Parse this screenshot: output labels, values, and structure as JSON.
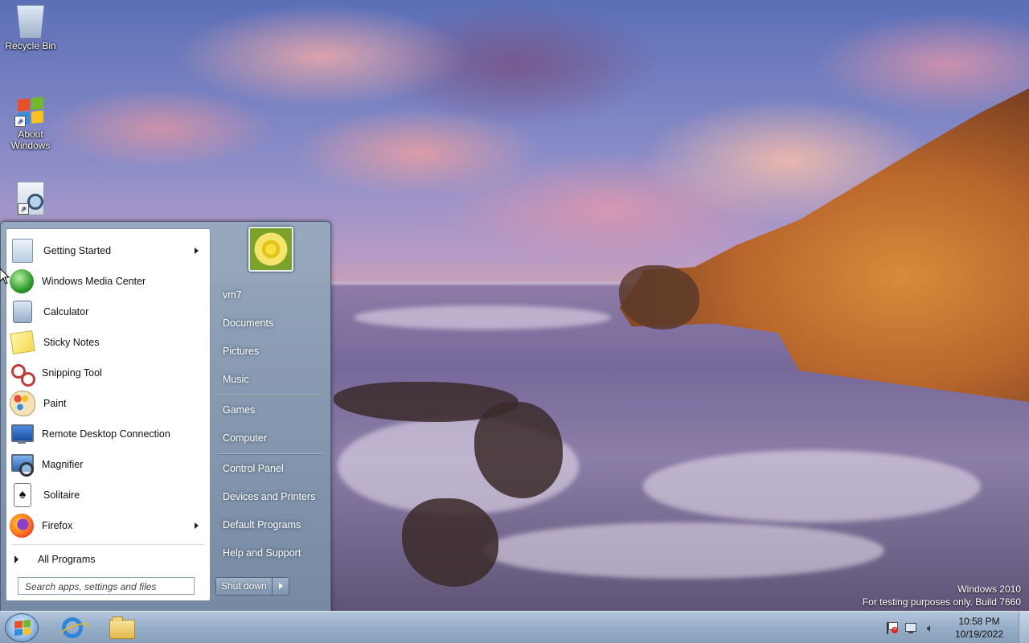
{
  "desktop": {
    "icons": [
      {
        "label": "Recycle Bin"
      },
      {
        "label": "About\nWindows"
      },
      {
        "label": ""
      }
    ],
    "watermark": {
      "line1": "Windows 2010",
      "line2": "For testing purposes only. Build 7660"
    }
  },
  "start_menu": {
    "programs": [
      {
        "label": "Getting Started",
        "icon": "getting-started-icon",
        "has_submenu": true
      },
      {
        "label": "Windows Media Center",
        "icon": "media-center-icon",
        "has_submenu": false
      },
      {
        "label": "Calculator",
        "icon": "calculator-icon",
        "has_submenu": false
      },
      {
        "label": "Sticky Notes",
        "icon": "sticky-notes-icon",
        "has_submenu": false
      },
      {
        "label": "Snipping Tool",
        "icon": "snipping-tool-icon",
        "has_submenu": false
      },
      {
        "label": "Paint",
        "icon": "paint-icon",
        "has_submenu": false
      },
      {
        "label": "Remote Desktop Connection",
        "icon": "remote-desktop-icon",
        "has_submenu": false
      },
      {
        "label": "Magnifier",
        "icon": "magnifier-icon",
        "has_submenu": false
      },
      {
        "label": "Solitaire",
        "icon": "solitaire-icon",
        "has_submenu": false
      },
      {
        "label": "Firefox",
        "icon": "firefox-icon",
        "has_submenu": true
      }
    ],
    "all_programs": "All Programs",
    "search_placeholder": "Search apps, settings and files",
    "right": {
      "user": "vm7",
      "documents": "Documents",
      "pictures": "Pictures",
      "music": "Music",
      "games": "Games",
      "computer": "Computer",
      "control_panel": "Control Panel",
      "devices": "Devices and Printers",
      "default_programs": "Default Programs",
      "help": "Help and Support"
    },
    "shutdown": "Shut down"
  },
  "taskbar": {
    "clock_time": "10:58 PM",
    "clock_date": "10/19/2022"
  },
  "colors": {
    "taskbar": "#96aec8",
    "start_menu_glass": "#8ea3bb"
  }
}
